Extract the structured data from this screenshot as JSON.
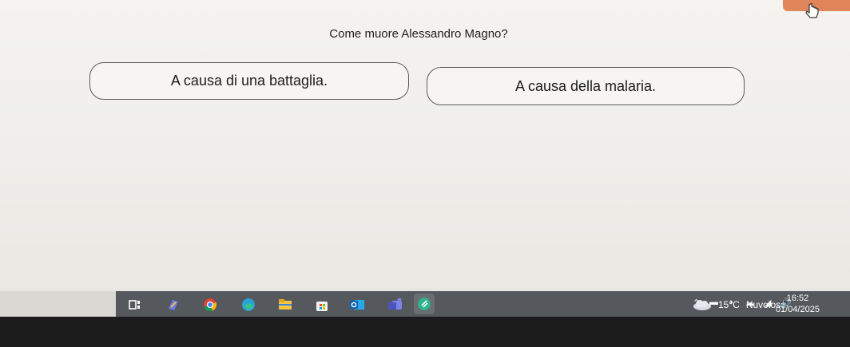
{
  "question": "Come muore Alessandro Magno?",
  "options": [
    {
      "label": "A causa di una battaglia."
    },
    {
      "label": "A causa della malaria."
    }
  ],
  "colors": {
    "accent": "#e0855a",
    "taskbar": "#55585d"
  },
  "taskbar": {
    "apps": [
      "taskview-icon",
      "copilot-icon",
      "chrome-icon",
      "edge-icon",
      "file-explorer-icon",
      "store-icon",
      "outlook-icon",
      "teams-icon",
      "clipchamp-icon"
    ],
    "weather": {
      "temp": "15°C",
      "condition": "Nuvoloso"
    },
    "clock": {
      "time": "16:52",
      "date": "01/04/2025"
    }
  }
}
